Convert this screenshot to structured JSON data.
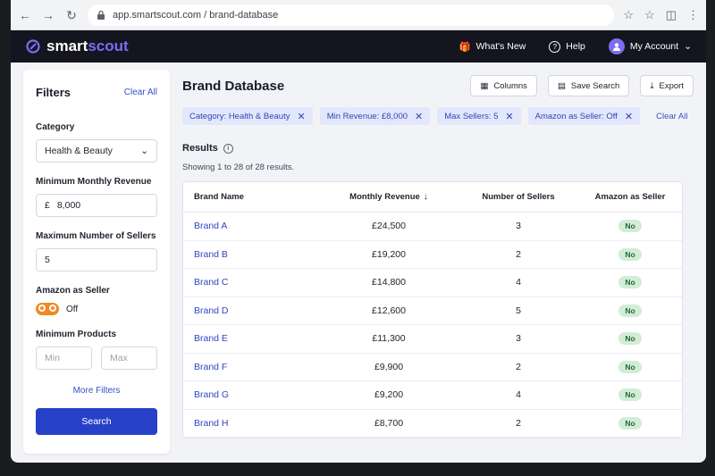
{
  "browser": {
    "url": "app.smartscout.com / brand-database"
  },
  "header": {
    "logo_primary": "smart",
    "logo_accent": "scout",
    "whats_new": "What's New",
    "help": "Help",
    "account": "My Account",
    "accent_color": "#7c6cf3"
  },
  "filters": {
    "title": "Filters",
    "clear_all": "Clear All",
    "category_label": "Category",
    "category_value": "Health & Beauty",
    "min_revenue_label": "Minimum Monthly Revenue",
    "currency": "£",
    "min_revenue_value": "8,000",
    "max_sellers_label": "Maximum Number of Sellers",
    "max_sellers_value": "5",
    "amazon_label": "Amazon as Seller",
    "amazon_value": "Off",
    "min_products_label": "Minimum Products",
    "min_placeholder": "Min",
    "max_placeholder": "Max",
    "more_filters": "More Filters",
    "search_button": "Search"
  },
  "main": {
    "title": "Brand Database",
    "columns_button": "Columns",
    "save_search_button": "Save Search",
    "export_button": "Export",
    "chips": [
      {
        "label": "Category: Health & Beauty"
      },
      {
        "label": "Min Revenue: £8,000"
      },
      {
        "label": "Max Sellers: 5"
      },
      {
        "label": "Amazon as Seller: Off"
      }
    ],
    "clear_all": "Clear All",
    "results_title": "Results",
    "results_count": "Showing 1 to 28 of 28 results.",
    "columns": {
      "brand": "Brand Name",
      "revenue": "Monthly Revenue",
      "sellers": "Number of Sellers",
      "amazon": "Amazon as Seller"
    },
    "rows": [
      {
        "brand": "Brand A",
        "revenue": "£24,500",
        "sellers": "3",
        "amazon": "No"
      },
      {
        "brand": "Brand B",
        "revenue": "£19,200",
        "sellers": "2",
        "amazon": "No"
      },
      {
        "brand": "Brand C",
        "revenue": "£14,800",
        "sellers": "4",
        "amazon": "No"
      },
      {
        "brand": "Brand D",
        "revenue": "£12,600",
        "sellers": "5",
        "amazon": "No"
      },
      {
        "brand": "Brand E",
        "revenue": "£11,300",
        "sellers": "3",
        "amazon": "No"
      },
      {
        "brand": "Brand F",
        "revenue": "£9,900",
        "sellers": "2",
        "amazon": "No"
      },
      {
        "brand": "Brand G",
        "revenue": "£9,200",
        "sellers": "4",
        "amazon": "No"
      },
      {
        "brand": "Brand H",
        "revenue": "£8,700",
        "sellers": "2",
        "amazon": "No"
      }
    ]
  }
}
